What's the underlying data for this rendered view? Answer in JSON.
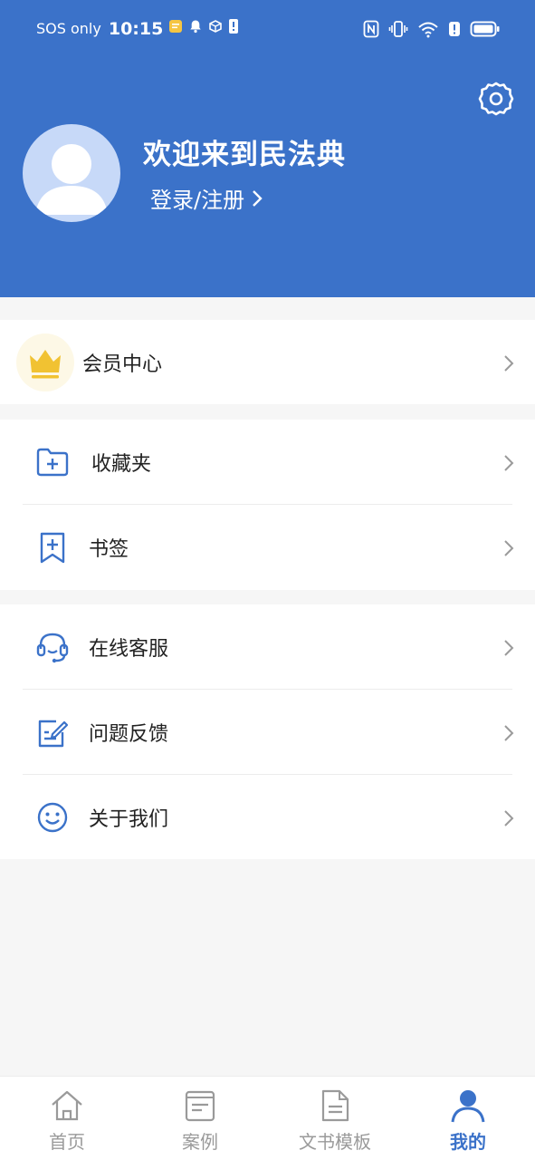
{
  "status_bar": {
    "carrier": "SOS only",
    "time": "10:15",
    "icons": [
      "notes-app-icon",
      "bell-icon",
      "box-icon",
      "alert-icon",
      "nfc-icon",
      "vibrate-icon",
      "wifi-icon",
      "alert-icon",
      "battery-icon"
    ]
  },
  "header": {
    "welcome": "欢迎来到民法典",
    "login_label": "登录/注册",
    "background_color": "#3b72c9"
  },
  "menu": {
    "member": {
      "label": "会员中心",
      "icon": "crown-icon"
    },
    "group1": [
      {
        "label": "收藏夹",
        "icon": "folder-plus-icon"
      },
      {
        "label": "书签",
        "icon": "bookmark-icon"
      }
    ],
    "group2": [
      {
        "label": "在线客服",
        "icon": "headset-icon"
      },
      {
        "label": "问题反馈",
        "icon": "feedback-icon"
      },
      {
        "label": "关于我们",
        "icon": "smile-icon"
      }
    ]
  },
  "tabbar": {
    "tabs": [
      {
        "label": "首页",
        "icon": "home-icon",
        "active": false
      },
      {
        "label": "案例",
        "icon": "case-icon",
        "active": false
      },
      {
        "label": "文书模板",
        "icon": "document-icon",
        "active": false
      },
      {
        "label": "我的",
        "icon": "user-icon",
        "active": true
      }
    ]
  },
  "colors": {
    "accent": "#3b72c9",
    "crown": "#f1c232",
    "icon_blue": "#3b72c9"
  }
}
